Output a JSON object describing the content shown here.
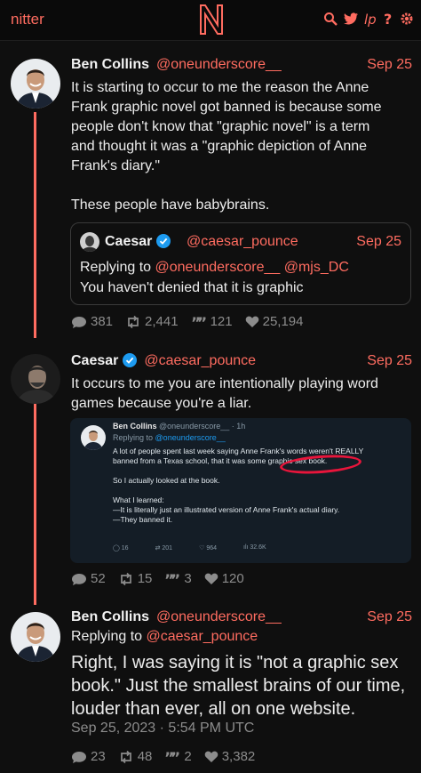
{
  "nav": {
    "brand": "nitter",
    "icons": [
      "search-icon",
      "twitter-bird-icon",
      "rss-icon",
      "help-icon",
      "settings-icon"
    ],
    "accent": "#ff6c60"
  },
  "tweets": [
    {
      "fullname": "Ben Collins",
      "username": "@oneunderscore__",
      "date": "Sep 25",
      "text": "It is starting to occur to me the reason the Anne\nFrank graphic novel got banned is because some\npeople don't know that \"graphic novel\" is a term\nand thought it was a \"graphic depiction of Anne\nFrank's diary.\"\n\nThese people have babybrains.",
      "quote": {
        "fullname": "Caesar",
        "username": "@caesar_pounce",
        "date": "Sep 25",
        "replying_prefix": "Replying to",
        "replying_to_1": "@oneunderscore__",
        "replying_to_2": "@mjs_DC",
        "text": "You haven't denied that it is graphic"
      },
      "stats": {
        "replies": "381",
        "retweets": "2,441",
        "quotes": "121",
        "likes": "25,194"
      }
    },
    {
      "fullname": "Caesar",
      "username": "@caesar_pounce",
      "date": "Sep 25",
      "text": "It occurs to me you are intentionally playing word\ngames because you're a liar.",
      "media": {
        "fullname": "Ben Collins",
        "handle": "@oneunderscore__ · 1h",
        "replying_prefix": "Replying to",
        "replying_to": "@oneunderscore__",
        "body": "A lot of people spent last week saying Anne Frank's words weren't REALLY\nbanned from a Texas school, that it was some graphic sex book.\n\nSo I actually looked at the book.\n\nWhat I learned:\n—It is literally just an illustrated version of Anne Frank's actual diary.\n—They banned it.",
        "stats": {
          "replies": "16",
          "retweets": "201",
          "likes": "964",
          "views": "32.6K"
        }
      },
      "stats": {
        "replies": "52",
        "retweets": "15",
        "quotes": "3",
        "likes": "120"
      }
    },
    {
      "fullname": "Ben Collins",
      "username": "@oneunderscore__",
      "date": "Sep 25",
      "replying_prefix": "Replying to",
      "replying_to": "@caesar_pounce",
      "text": "Right, I was saying it is \"not a graphic sex\nbook.\" Just the smallest brains of our time,\nlouder than ever, all on one website.",
      "published": "Sep 25, 2023 · 5:54 PM UTC",
      "stats": {
        "replies": "23",
        "retweets": "48",
        "quotes": "2",
        "likes": "3,382"
      }
    }
  ]
}
